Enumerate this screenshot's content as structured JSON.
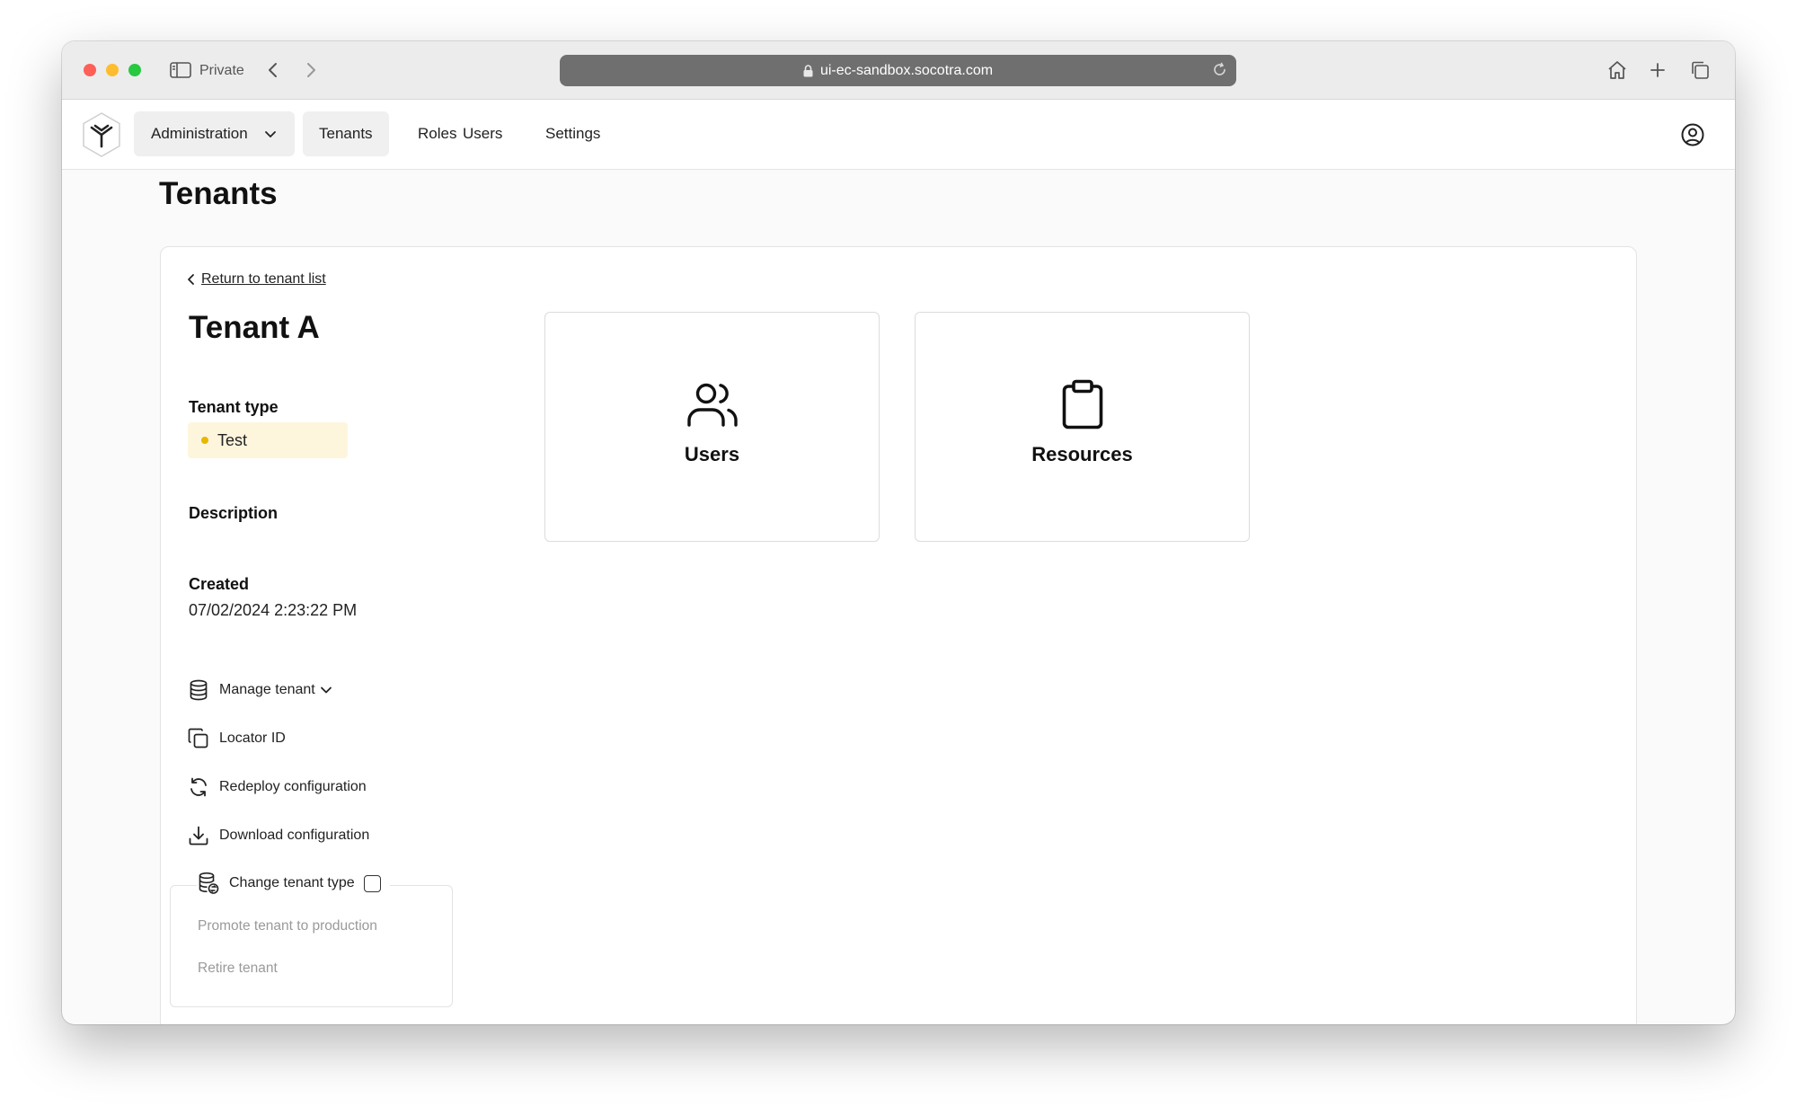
{
  "browser": {
    "mode_label": "Private",
    "url": "ui-ec-sandbox.socotra.com"
  },
  "header": {
    "dropdown_label": "Administration",
    "nav": [
      {
        "label": "Tenants",
        "active": true
      },
      {
        "label": "Roles",
        "active": false
      },
      {
        "label": "Users",
        "active": false
      },
      {
        "label": "Settings",
        "active": false
      }
    ]
  },
  "page": {
    "title": "Tenants",
    "return_link": "Return to tenant list",
    "tenant_name": "Tenant A",
    "tenant_type_label": "Tenant type",
    "tenant_type_value": "Test",
    "tenant_type_color": "#e6b800",
    "description_label": "Description",
    "created_label": "Created",
    "created_value": "07/02/2024 2:23:22 PM",
    "actions": {
      "manage": "Manage tenant",
      "locator": "Locator ID",
      "redeploy": "Redeploy configuration",
      "download": "Download configuration",
      "change_type": "Change tenant type"
    },
    "change_type_options": {
      "promote": "Promote tenant to production",
      "retire": "Retire tenant"
    },
    "tiles": {
      "users": "Users",
      "resources": "Resources"
    }
  }
}
